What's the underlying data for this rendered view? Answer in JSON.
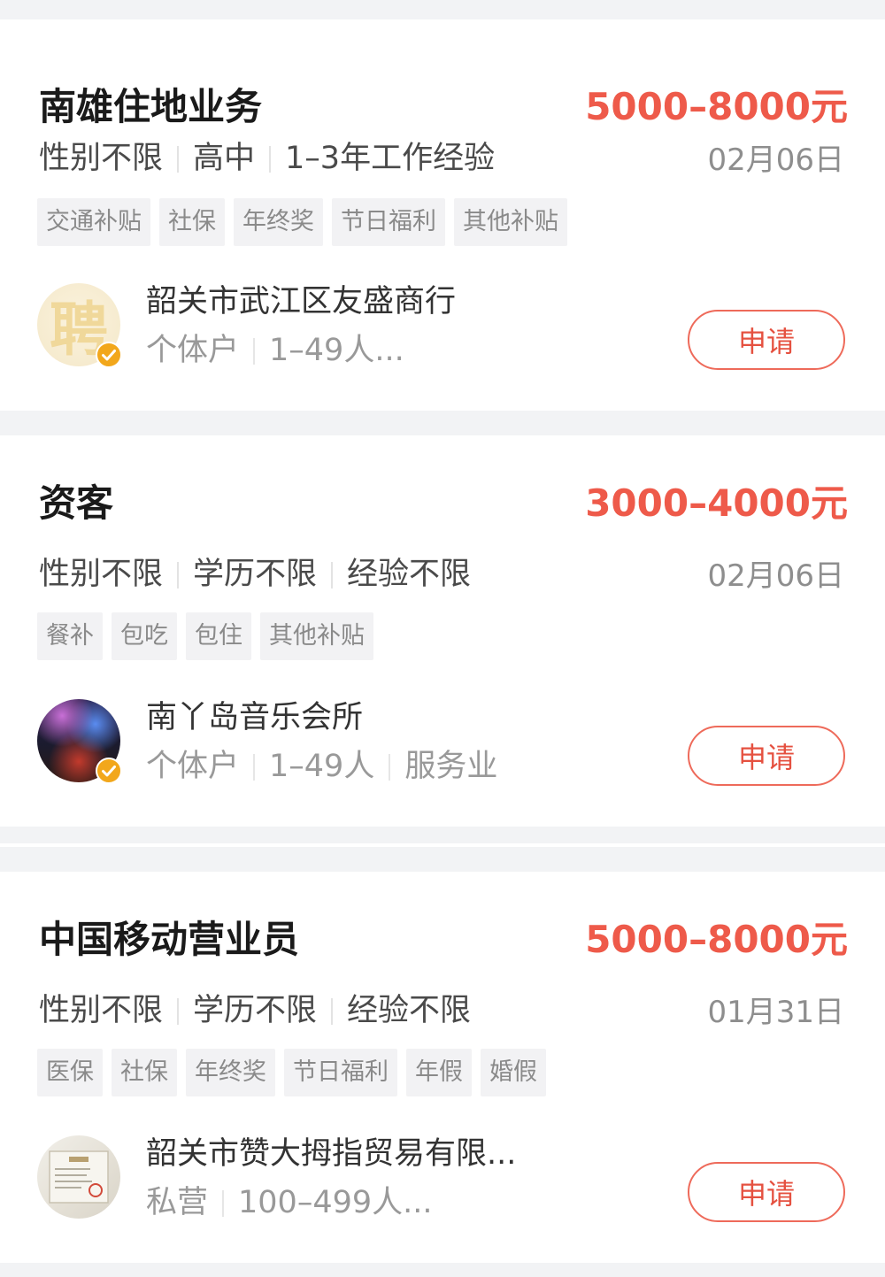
{
  "jobs": [
    {
      "title": "南雄住地业务",
      "salary": "5000–8000元",
      "requirements": [
        "性别不限",
        "高中",
        "1–3年工作经验"
      ],
      "date": "02月06日",
      "tags": [
        "交通补贴",
        "社保",
        "年终奖",
        "节日福利",
        "其他补贴"
      ],
      "company": "韶关市武江区友盛商行",
      "company_meta": [
        "个体户",
        "1–49人..."
      ],
      "avatar": "pin-logo-avatar",
      "apply_label": "申请"
    },
    {
      "title": "资客",
      "salary": "3000–4000元",
      "requirements": [
        "性别不限",
        "学历不限",
        "经验不限"
      ],
      "date": "02月06日",
      "tags": [
        "餐补",
        "包吃",
        "包住",
        "其他补贴"
      ],
      "company": "南丫岛音乐会所",
      "company_meta": [
        "个体户",
        "1–49人",
        "服务业"
      ],
      "avatar": "club-photo-avatar",
      "apply_label": "申请"
    },
    {
      "title": "中国移动营业员",
      "salary": "5000–8000元",
      "requirements": [
        "性别不限",
        "学历不限",
        "经验不限"
      ],
      "date": "01月31日",
      "tags": [
        "医保",
        "社保",
        "年终奖",
        "节日福利",
        "年假",
        "婚假"
      ],
      "company": "韶关市赞大拇指贸易有限...",
      "company_meta": [
        "私营",
        "100–499人..."
      ],
      "avatar": "business-license-avatar",
      "apply_label": "申请"
    }
  ],
  "avatar_pin_char": "聘",
  "colors": {
    "salary": "#ee5a4a",
    "apply_border": "#ee6a5a",
    "verified_badge": "#f2a71b",
    "background": "#f2f3f5"
  }
}
